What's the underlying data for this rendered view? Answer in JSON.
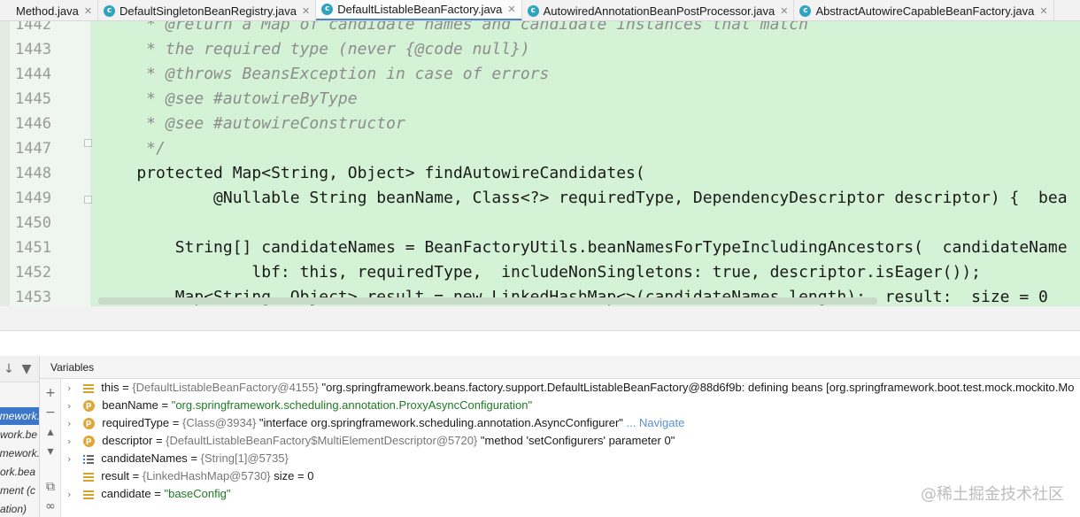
{
  "tabs": [
    {
      "label": "Method.java",
      "icon": "class-icon",
      "active": false
    },
    {
      "label": "DefaultSingletonBeanRegistry.java",
      "icon": "class-icon",
      "active": false
    },
    {
      "label": "DefaultListableBeanFactory.java",
      "icon": "class-icon",
      "active": true
    },
    {
      "label": "AutowiredAnnotationBeanPostProcessor.java",
      "icon": "class-icon",
      "active": false
    },
    {
      "label": "AbstractAutowireCapableBeanFactory.java",
      "icon": "class-icon",
      "active": false
    }
  ],
  "editor": {
    "lines": [
      {
        "n": "1442",
        "text": "     * @return a Map of candidate names and candidate instances that match"
      },
      {
        "n": "1443",
        "text": "     * the required type (never {@code null})"
      },
      {
        "n": "1444",
        "text": "     * @throws BeansException in case of errors"
      },
      {
        "n": "1445",
        "text": "     * @see #autowireByType"
      },
      {
        "n": "1446",
        "text": "     * @see #autowireConstructor"
      },
      {
        "n": "1447",
        "text": "     */"
      },
      {
        "n": "1448",
        "text": "    protected Map<String, Object> findAutowireCandidates("
      },
      {
        "n": "1449",
        "text": "            @Nullable String beanName, Class<?> requiredType, DependencyDescriptor descriptor) {  bea"
      },
      {
        "n": "1450",
        "text": ""
      },
      {
        "n": "1451",
        "text": "        String[] candidateNames = BeanFactoryUtils.beanNamesForTypeIncludingAncestors(  candidateName"
      },
      {
        "n": "1452",
        "text": "                lbf: this, requiredType,  includeNonSingletons: true, descriptor.isEager());"
      },
      {
        "n": "1453",
        "text": "        Map<String, Object> result = new LinkedHashMap<>(candidateNames.length);  result:  size = 0"
      }
    ]
  },
  "debug": {
    "panel_title": "Variables",
    "frames": [
      "framework.",
      "work.be",
      "amework.",
      "ork.bea",
      "ment (c",
      "ation)"
    ],
    "variables": [
      {
        "name": "this",
        "icon": "field-icon",
        "expandable": true,
        "obj": "{DefaultListableBeanFactory@4155}",
        "value": "\"org.springframework.beans.factory.support.DefaultListableBeanFactory@88d6f9b: defining beans [org.springframework.boot.test.mock.mockito.Mo",
        "link": ""
      },
      {
        "name": "beanName",
        "icon": "parameter-icon",
        "expandable": true,
        "obj": "",
        "value": "\"org.springframework.scheduling.annotation.ProxyAsyncConfiguration\"",
        "link": ""
      },
      {
        "name": "requiredType",
        "icon": "parameter-icon",
        "expandable": true,
        "obj": "{Class@3934}",
        "value": "\"interface org.springframework.scheduling.annotation.AsyncConfigurer\"",
        "link": "... Navigate"
      },
      {
        "name": "descriptor",
        "icon": "parameter-icon",
        "expandable": true,
        "obj": "{DefaultListableBeanFactory$MultiElementDescriptor@5720}",
        "value": "\"method 'setConfigurers' parameter 0\"",
        "link": ""
      },
      {
        "name": "candidateNames",
        "icon": "array-icon",
        "expandable": true,
        "obj": "{String[1]@5735}",
        "value": "",
        "link": ""
      },
      {
        "name": "result",
        "icon": "field-icon",
        "expandable": false,
        "obj": "{LinkedHashMap@5730}",
        "value": " size = 0",
        "link": ""
      },
      {
        "name": "candidate",
        "icon": "field-icon",
        "expandable": true,
        "obj": "",
        "value": "\"baseConfig\"",
        "link": ""
      }
    ]
  },
  "watermark": "@稀土掘金技术社区"
}
